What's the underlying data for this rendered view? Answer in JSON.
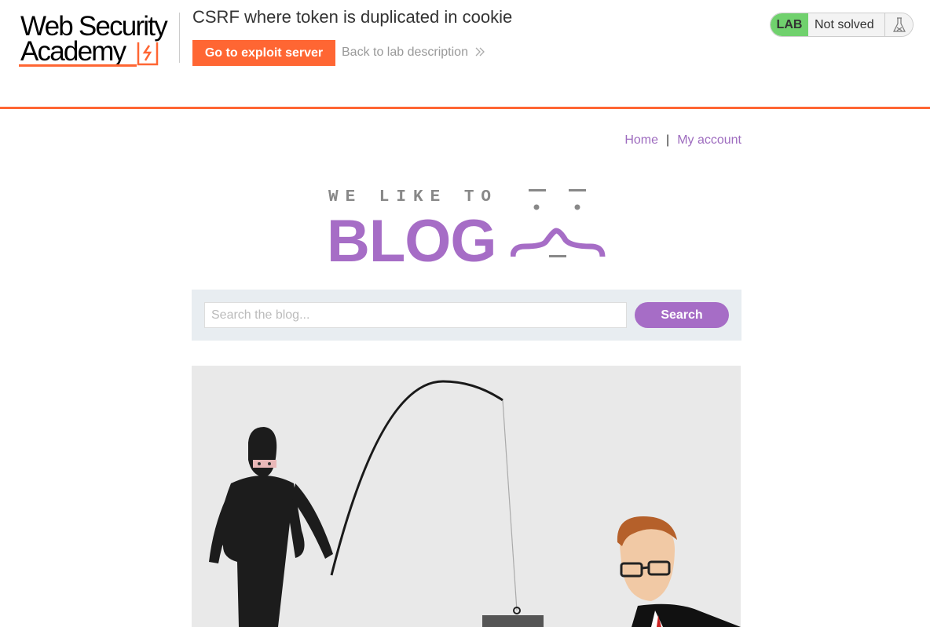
{
  "header": {
    "logo_line1": "Web Security",
    "logo_line2": "Academy",
    "lab_title": "CSRF where token is duplicated in cookie",
    "exploit_button": "Go to exploit server",
    "back_link": "Back to lab description",
    "lab_badge": "LAB",
    "lab_status": "Not solved",
    "accent_color": "#ff6633"
  },
  "nav": {
    "home": "Home",
    "separator": "|",
    "my_account": "My account"
  },
  "blog_logo": {
    "tagline": "WE LIKE TO",
    "word": "BLOG",
    "color": "#a66dc6"
  },
  "search": {
    "placeholder": "Search the blog...",
    "button": "Search"
  },
  "icons": {
    "flask": "flask-icon",
    "chevron": "double-chevron-right-icon"
  }
}
